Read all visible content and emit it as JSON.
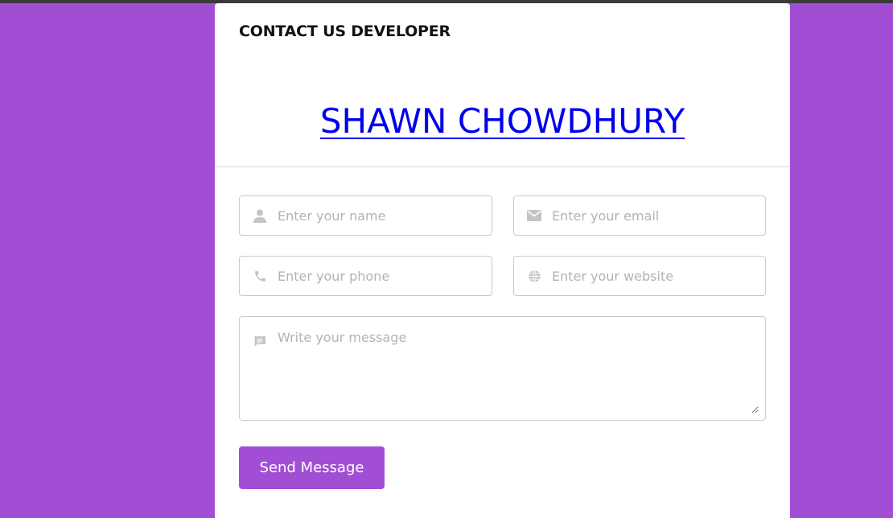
{
  "card": {
    "title": "CONTACT US DEVELOPER",
    "developer_name": "SHAWN CHOWDHURY"
  },
  "form": {
    "name": {
      "placeholder": "Enter your name",
      "value": "",
      "icon": "user-icon"
    },
    "email": {
      "placeholder": "Enter your email",
      "value": "",
      "icon": "envelope-icon"
    },
    "phone": {
      "placeholder": "Enter your phone",
      "value": "",
      "icon": "phone-icon"
    },
    "website": {
      "placeholder": "Enter your website",
      "value": "",
      "icon": "globe-icon"
    },
    "message": {
      "placeholder": "Write your message",
      "value": "",
      "icon": "message-icon"
    },
    "submit_label": "Send Message"
  },
  "colors": {
    "background": "#a24ed4",
    "button": "#a24ed4",
    "link": "#0000ee",
    "icon": "#c4c4c4"
  }
}
